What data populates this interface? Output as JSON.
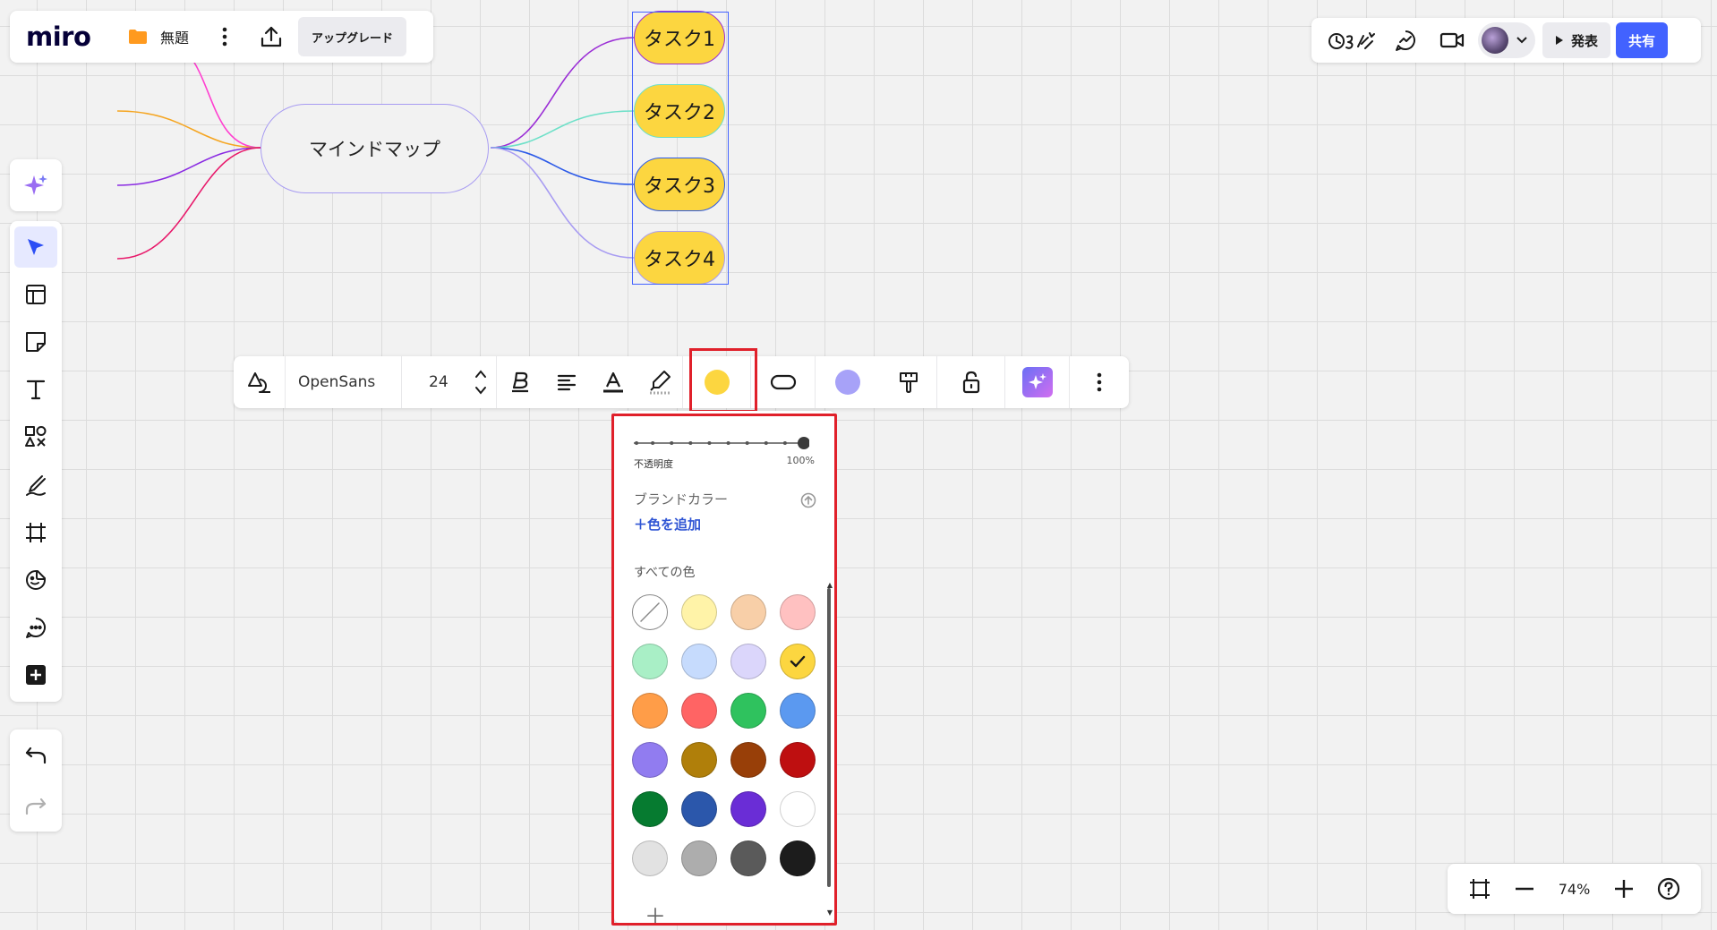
{
  "topbar": {
    "logo": "miro",
    "board_title": "無題",
    "upgrade_label": "アップグレード"
  },
  "topbar_right": {
    "present_label": "発表",
    "share_label": "共有"
  },
  "mindmap": {
    "root_label": "マインドマップ",
    "tasks": [
      {
        "label": "タスク1",
        "branch_color": "#9b2fd6"
      },
      {
        "label": "タスク2",
        "branch_color": "#6ee0c8"
      },
      {
        "label": "タスク3",
        "branch_color": "#2c5ae8"
      },
      {
        "label": "タスク4",
        "branch_color": "#a89cf2"
      }
    ],
    "left_branch_colors": [
      "#ff3fd0",
      "#f5a623",
      "#8a2be2",
      "#e8186a"
    ]
  },
  "context_toolbar": {
    "font_family": "OpenSans",
    "font_size": "24",
    "fill_color": "#fcd640",
    "border_color": "#a7a2f8"
  },
  "color_picker": {
    "opacity_label": "不透明度",
    "opacity_value": "100%",
    "opacity": 1.0,
    "brand_colors_heading": "ブランドカラー",
    "add_color_label": "＋色を追加",
    "all_colors_heading": "すべての色",
    "selected_color": "#fcd640",
    "swatches": [
      "none",
      "#fff3a8",
      "#f8cfa8",
      "#ffc1c1",
      "#a9efc6",
      "#c6dbfd",
      "#dbd6fb",
      "#fcd640",
      "#ff9d48",
      "#ff6464",
      "#2fc25e",
      "#5b99f0",
      "#917cf0",
      "#b07f0a",
      "#983f08",
      "#be0f10",
      "#067b30",
      "#2b57ab",
      "#6a2dd6",
      "#ffffff",
      "#e2e2e2",
      "#adadad",
      "#5a5a5a",
      "#1c1c1c"
    ]
  },
  "zoom": {
    "value": "74%"
  }
}
